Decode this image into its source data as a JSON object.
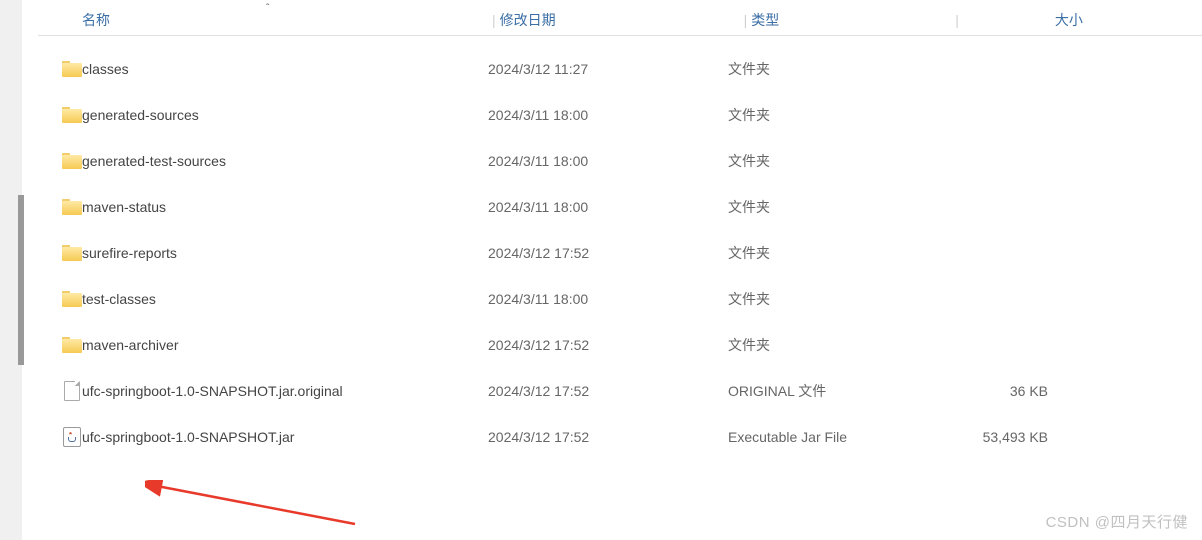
{
  "columns": {
    "name": "名称",
    "date": "修改日期",
    "type": "类型",
    "size": "大小"
  },
  "sort_indicator": "ˆ",
  "files": [
    {
      "icon": "folder",
      "name": "classes",
      "date": "2024/3/12 11:27",
      "type": "文件夹",
      "size": ""
    },
    {
      "icon": "folder",
      "name": "generated-sources",
      "date": "2024/3/11 18:00",
      "type": "文件夹",
      "size": ""
    },
    {
      "icon": "folder",
      "name": "generated-test-sources",
      "date": "2024/3/11 18:00",
      "type": "文件夹",
      "size": ""
    },
    {
      "icon": "folder",
      "name": "maven-status",
      "date": "2024/3/11 18:00",
      "type": "文件夹",
      "size": ""
    },
    {
      "icon": "folder",
      "name": "surefire-reports",
      "date": "2024/3/12 17:52",
      "type": "文件夹",
      "size": ""
    },
    {
      "icon": "folder",
      "name": "test-classes",
      "date": "2024/3/11 18:00",
      "type": "文件夹",
      "size": ""
    },
    {
      "icon": "folder",
      "name": "maven-archiver",
      "date": "2024/3/12 17:52",
      "type": "文件夹",
      "size": ""
    },
    {
      "icon": "file",
      "name": "ufc-springboot-1.0-SNAPSHOT.jar.original",
      "date": "2024/3/12 17:52",
      "type": "ORIGINAL 文件",
      "size": "36 KB"
    },
    {
      "icon": "jar",
      "name": "ufc-springboot-1.0-SNAPSHOT.jar",
      "date": "2024/3/12 17:52",
      "type": "Executable Jar File",
      "size": "53,493 KB"
    }
  ],
  "watermark": "CSDN @四月天行健"
}
